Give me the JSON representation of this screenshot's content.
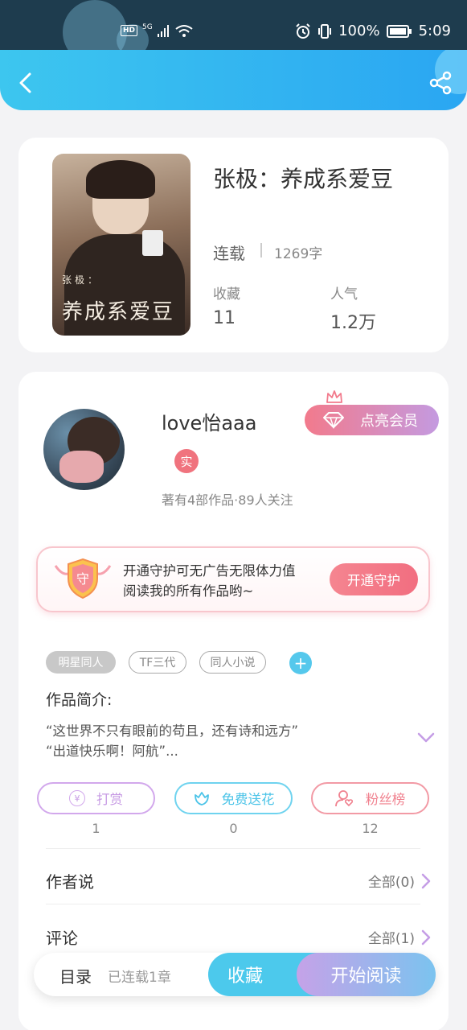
{
  "status_bar": {
    "network_hd": "HD",
    "network_type": "5G",
    "battery_percent": "100%",
    "time": "5:09"
  },
  "book": {
    "cover_small_text": "张极：",
    "cover_big_text": "养成系爱豆",
    "title": "张极：养成系爱豆",
    "status": "连载",
    "word_count": "1269字",
    "favorites_label": "收藏",
    "favorites_value": "11",
    "popularity_label": "人气",
    "popularity_value": "1.2万"
  },
  "author": {
    "name": "love怡aaa",
    "verified_badge": "实",
    "meta": "著有4部作品·89人关注",
    "vip_button": "点亮会员"
  },
  "guard": {
    "shield_char": "守",
    "text_line1": "开通守护可无广告无限体力值",
    "text_line2": "阅读我的所有作品哟~",
    "button": "开通守护"
  },
  "tags": [
    "明星同人",
    "TF三代",
    "同人小说"
  ],
  "tag_add": "+",
  "intro": {
    "heading": "作品简介:",
    "line1": "“这世界不只有眼前的苟且，还有诗和远方”",
    "line2": "“出道快乐啊！阿航”..."
  },
  "actions": {
    "reward": {
      "label": "打赏",
      "icon_char": "¥",
      "count": "1"
    },
    "flower": {
      "label": "免费送花",
      "count": "0"
    },
    "fans": {
      "label": "粉丝榜",
      "count": "12"
    }
  },
  "author_says": {
    "title": "作者说",
    "all": "全部(0)"
  },
  "comments": {
    "title": "评论",
    "all": "全部(1)"
  },
  "bottom_bar": {
    "catalog": "目录",
    "progress": "已连载1章",
    "favorite": "收藏",
    "read": "开始阅读"
  },
  "colors": {
    "header_start": "#3dc6ef",
    "header_end": "#2aa6f2",
    "accent_pink": "#f27a8c",
    "accent_purple": "#c49ae0",
    "accent_blue": "#4cc9ec"
  }
}
